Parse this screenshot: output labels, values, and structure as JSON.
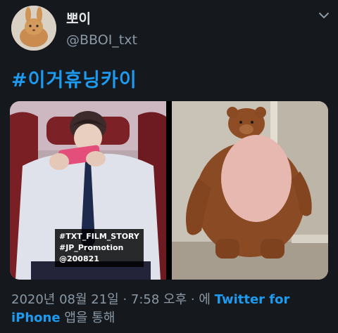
{
  "user": {
    "display_name": "뽀이",
    "handle": "@BBOI_txt"
  },
  "icons": {
    "more": "chevron-down-icon"
  },
  "tweet": {
    "hashtag": "#이거휴닝카이",
    "media_caption": [
      "#TXT_FILM_STORY",
      "#JP_Promotion",
      "@200821"
    ]
  },
  "meta": {
    "timestamp": "2020년 08월 21일 · 7:58 오후 · 에",
    "source_part1": "Twitter for",
    "source_part2": "iPhone",
    "suffix": "앱을 통해"
  },
  "colors": {
    "background": "#15181c",
    "accent": "#1d9bf0",
    "secondary_text": "#8b98a5"
  }
}
